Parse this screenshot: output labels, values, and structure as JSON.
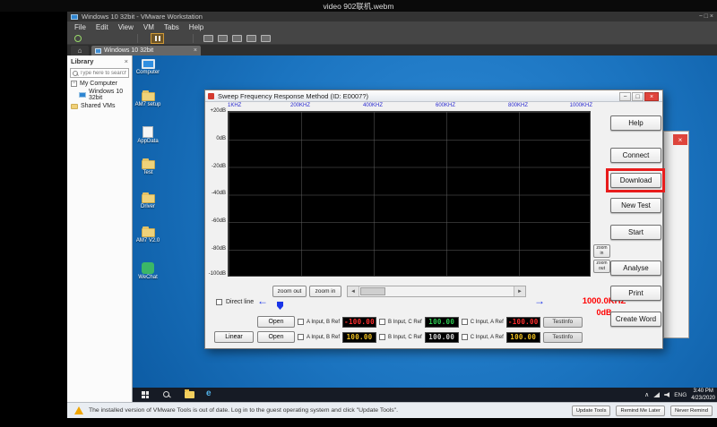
{
  "colors": {
    "red": "#ff2e2e",
    "green": "#2ecc52",
    "yellow": "#f0c020",
    "white": "#d8d8d8",
    "readout_red": "#ff0000",
    "accent_blue": "#1a35e8",
    "annotation_red": "#e81c1c"
  },
  "video": {
    "title": "video 902联机.webm"
  },
  "vmware": {
    "window_title": "Windows 10 32bit - VMware Workstation",
    "menu": [
      "File",
      "Edit",
      "View",
      "VM",
      "Tabs",
      "Help"
    ],
    "tabs": {
      "vm_label": "Windows 10 32bit"
    },
    "library": {
      "title": "Library",
      "search_placeholder": "Type here to search",
      "my_computer": "My Computer",
      "vm_item": "Windows 10 32bit",
      "shared": "Shared VMs"
    },
    "status": {
      "message": "The installed version of VMware Tools is out of date. Log in to the guest operating system and click \"Update Tools\".",
      "update": "Update Tools",
      "remind": "Remind Me Later",
      "never": "Never Remind"
    }
  },
  "desktop": {
    "icons": [
      {
        "label": "Computer"
      },
      {
        "label": "AM7 setup"
      },
      {
        "label": "AppData"
      },
      {
        "label": "Test"
      },
      {
        "label": "Driver"
      },
      {
        "label": "AM7 V2.0"
      },
      {
        "label": "WeChat"
      }
    ],
    "tray": {
      "lang": "ENG",
      "time": "3:40 PM",
      "date": "4/23/2020"
    }
  },
  "app": {
    "title": "Sweep Frequency Response Method   (ID:   E0007?)",
    "chart": {
      "type": "line",
      "x_labels": [
        "1KHZ",
        "200KHZ",
        "400KHZ",
        "600KHZ",
        "800KHZ",
        "1000KHZ"
      ],
      "y_labels": [
        "+20dB",
        "0dB",
        "-20dB",
        "-40dB",
        "-60dB",
        "-80dB",
        "-100dB"
      ],
      "series": []
    },
    "side_buttons": [
      "Help",
      "Connect",
      "Download",
      "New Test",
      "Start",
      "Analyse",
      "Print",
      "Create Word"
    ],
    "zoom_out": "zoom out",
    "zoom_in": "zoom in",
    "side_zoom_in": "zoom in",
    "side_zoom_out": "zoom out",
    "direct_line": "Direct line",
    "readout": {
      "freq": "1000.0KHZ",
      "db": "0dB"
    },
    "open": "Open",
    "linear": "Linear",
    "testinfo": "TestInfo",
    "row1": {
      "f1_label": "A Input,  B Ref",
      "f1_value": "-100.00",
      "f2_label": "B Input,  C Ref",
      "f2_value": "100.00",
      "f3_label": "C Input,  A Ref",
      "f3_value": "-100.00"
    },
    "row2": {
      "f1_label": "A Input,  B Ref",
      "f1_value": "100.00",
      "f2_label": "B Input,  C Ref",
      "f2_value": "100.00",
      "f3_label": "C Input,  A Ref",
      "f3_value": "100.00"
    }
  }
}
